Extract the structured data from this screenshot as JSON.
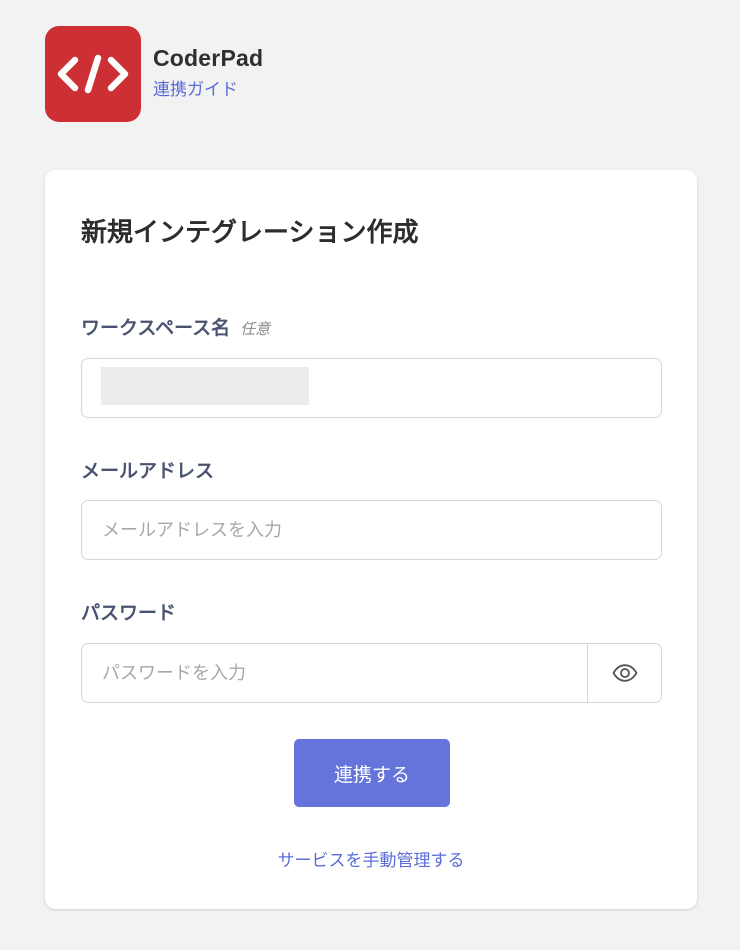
{
  "app": {
    "name": "CoderPad",
    "guide_link": "連携ガイド"
  },
  "form": {
    "title": "新規インテグレーション作成",
    "workspace": {
      "label": "ワークスペース名",
      "optional_tag": "任意",
      "value": ""
    },
    "email": {
      "label": "メールアドレス",
      "placeholder": "メールアドレスを入力"
    },
    "password": {
      "label": "パスワード",
      "placeholder": "パスワードを入力"
    },
    "submit_label": "連携する",
    "manual_link": "サービスを手動管理する"
  },
  "icons": {
    "logo": "code-brackets-icon",
    "password_toggle": "eye-icon"
  },
  "colors": {
    "logo_bg": "#cc3035",
    "accent": "#6574db",
    "link": "#5a6cd9",
    "label": "#4a5470"
  }
}
